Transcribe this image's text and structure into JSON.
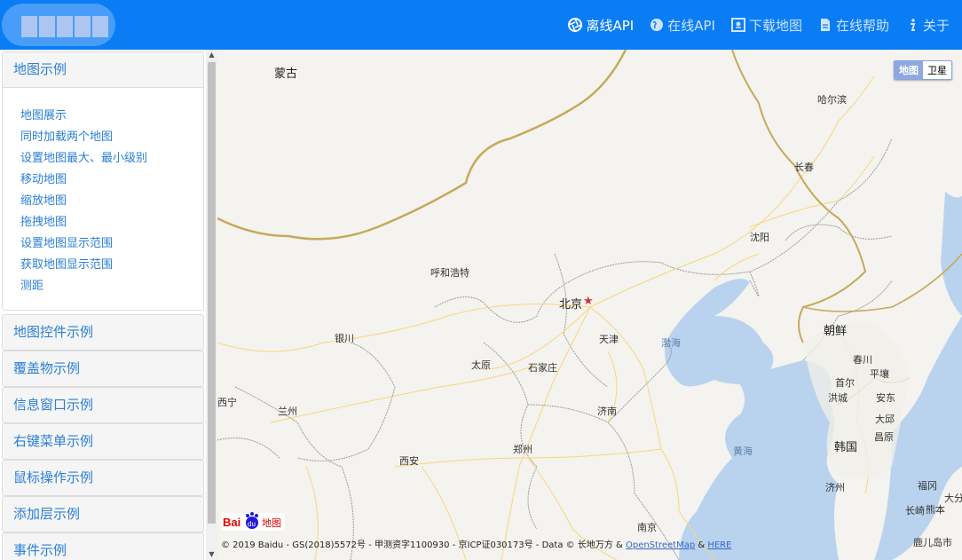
{
  "nav": {
    "items": [
      {
        "label": "离线API",
        "icon": "aperture-icon",
        "active": true
      },
      {
        "label": "在线API",
        "icon": "globe-icon",
        "active": false
      },
      {
        "label": "下载地图",
        "icon": "download-map-icon",
        "active": false
      },
      {
        "label": "在线帮助",
        "icon": "document-icon",
        "active": false
      },
      {
        "label": "关于",
        "icon": "info-icon",
        "active": false
      }
    ]
  },
  "sidebar": {
    "panels": [
      {
        "title": "地图示例",
        "expanded": true,
        "links": [
          "地图展示",
          "同时加载两个地图",
          "设置地图最大、最小级别",
          "移动地图",
          "缩放地图",
          "拖拽地图",
          "设置地图显示范围",
          "获取地图显示范围",
          "测距"
        ]
      },
      {
        "title": "地图控件示例"
      },
      {
        "title": "覆盖物示例"
      },
      {
        "title": "信息窗口示例"
      },
      {
        "title": "右键菜单示例"
      },
      {
        "title": "鼠标操作示例"
      },
      {
        "title": "添加层示例"
      },
      {
        "title": "事件示例"
      }
    ]
  },
  "map": {
    "type_control": {
      "map": "地图",
      "satellite": "卫星"
    },
    "labels": {
      "mongolia": "蒙古",
      "harbin": "哈尔滨",
      "changchun": "长春",
      "shenyang": "沈阳",
      "hohhot": "呼和浩特",
      "beijing": "北京",
      "tianjin": "天津",
      "yinchuan": "银川",
      "taiyuan": "太原",
      "shijiazhuang": "石家庄",
      "bohai": "渤海",
      "north_korea": "朝鲜",
      "pyongyang": "平壤",
      "seoul": "首尔",
      "chuncheon": "春川",
      "hongcheon": "洪城",
      "andong": "安东",
      "daegu": "大邱",
      "korea": "韩国",
      "changwon": "昌原",
      "jinan": "济南",
      "lanzhou": "兰州",
      "xining": "西宁",
      "xian": "西安",
      "zhengzhou": "郑州",
      "yellow_sea": "黄海",
      "jeju": "济州",
      "fukuoka": "福冈",
      "oita": "大分",
      "kumamoto": "熊本",
      "nagasaki": "长崎",
      "kagoshima": "鹿儿岛市",
      "nanjing": "南京"
    },
    "baidu_logo": "Bai地图",
    "copyright": "© 2019 Baidu - GS(2018)5572号 - 甲测资字1100930 - 京ICP证030173号 - Data © 长地万方 & ",
    "copyright_links": [
      "OpenStreetMap",
      "HERE"
    ],
    "copyright_amp": " & "
  },
  "colors": {
    "topbar": "#0a7df5",
    "link": "#2a7fd4",
    "sea": "#b9d3ee",
    "land": "#f4f3ef",
    "border": "#c6a95b",
    "road": "#f7d77a"
  }
}
